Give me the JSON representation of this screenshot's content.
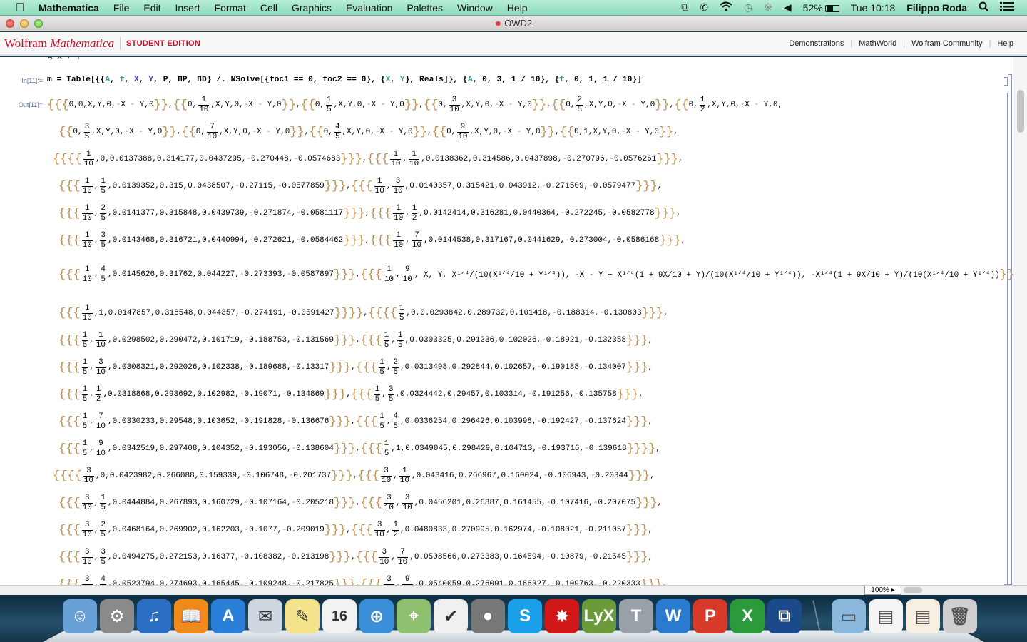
{
  "menubar": {
    "apple_icon": "apple-logo-icon",
    "app_name": "Mathematica",
    "menus": [
      "File",
      "Edit",
      "Insert",
      "Format",
      "Cell",
      "Graphics",
      "Evaluation",
      "Palettes",
      "Window",
      "Help"
    ],
    "status_icons": [
      "screen-mirroring-icon",
      "phone-icon",
      "wifi-icon",
      "time-machine-icon",
      "bluetooth-icon",
      "volume-icon"
    ],
    "battery": "52%",
    "clock": "Tue 10:18",
    "user": "Filippo Roda",
    "spotlight_icon": "search-icon",
    "notification_icon": "list-icon"
  },
  "window": {
    "title": "OWD2"
  },
  "wolfram_header": {
    "brand_wolfram": "Wolfram",
    "brand_mathematica": "Mathematica",
    "edition": "STUDENT EDITION",
    "links": [
      "Demonstrations",
      "MathWorld",
      "Wolfram Community",
      "Help"
    ]
  },
  "notebook": {
    "cut_text": "A X    + Y",
    "input_label": "In[11]:=",
    "output_label": "Out[11]=",
    "input_code": "m = Table[{{A, f, X, Y, P, ΠP, ΠD} /. NSolve[{foc1 == 0, foc2 == 0}, {X, Y}, Reals]}, {A, 0, 3, 1/10}, {f, 0, 1, 1/10}]",
    "input_parts": {
      "p1": "m = Table[{{",
      "A": "A",
      "c1": ", ",
      "f": "f",
      "c2": ", ",
      "X": "X",
      "c3": ", ",
      "Y": "Y",
      "p2": ", P, ΠP, ΠD} /. NSolve[{foc1 == 0, foc2 == 0}, {",
      "X2": "X",
      "c4": ", ",
      "Y2": "Y",
      "p3": "}, Reals]}, {",
      "A2": "A",
      "p4": ", 0, 3, 1 / 10}, {",
      "f2": "f",
      "p5": ", 0, 1, 1 / 10}]"
    },
    "symbolic_rows": [
      {
        "A": "0",
        "f": "0",
        "rest": "X, Y, 0, -X-Y, 0"
      },
      {
        "A": "0",
        "f": "1/10",
        "rest": "X, Y, 0, -X-Y, 0"
      },
      {
        "A": "0",
        "f": "1/5",
        "rest": "X, Y, 0, -X-Y, 0"
      },
      {
        "A": "0",
        "f": "3/10",
        "rest": "X, Y, 0, -X-Y, 0"
      },
      {
        "A": "0",
        "f": "2/5",
        "rest": "X, Y, 0, -X-Y, 0"
      },
      {
        "A": "0",
        "f": "1/2",
        "rest": "X, Y, 0, -X-Y, 0"
      },
      {
        "A": "0",
        "f": "3/5",
        "rest": "X, Y, 0, -X-Y, 0"
      },
      {
        "A": "0",
        "f": "7/10",
        "rest": "X, Y, 0, -X-Y, 0"
      },
      {
        "A": "0",
        "f": "4/5",
        "rest": "X, Y, 0, -X-Y, 0"
      },
      {
        "A": "0",
        "f": "9/10",
        "rest": "X, Y, 0, -X-Y, 0"
      },
      {
        "A": "0",
        "f": "1",
        "rest": "X, Y, 0, -X-Y, 0"
      }
    ],
    "numeric_rows": [
      {
        "A": "1/10",
        "f": "0",
        "v": [
          "0.0137388",
          "0.314177",
          "0.0437295",
          "-0.270448",
          "-0.0574683"
        ]
      },
      {
        "A": "1/10",
        "f": "1/10",
        "v": [
          "0.0138362",
          "0.314586",
          "0.0437898",
          "-0.270796",
          "-0.0576261"
        ]
      },
      {
        "A": "1/10",
        "f": "1/5",
        "v": [
          "0.0139352",
          "0.315",
          "0.0438507",
          "-0.27115",
          "-0.0577859"
        ]
      },
      {
        "A": "1/10",
        "f": "3/10",
        "v": [
          "0.0140357",
          "0.315421",
          "0.043912",
          "-0.271509",
          "-0.0579477"
        ]
      },
      {
        "A": "1/10",
        "f": "2/5",
        "v": [
          "0.0141377",
          "0.315848",
          "0.0439739",
          "-0.271874",
          "-0.0581117"
        ]
      },
      {
        "A": "1/10",
        "f": "1/2",
        "v": [
          "0.0142414",
          "0.316281",
          "0.0440364",
          "-0.272245",
          "-0.0582778"
        ]
      },
      {
        "A": "1/10",
        "f": "3/5",
        "v": [
          "0.0143468",
          "0.316721",
          "0.0440994",
          "-0.272621",
          "-0.0584462"
        ]
      },
      {
        "A": "1/10",
        "f": "7/10",
        "v": [
          "0.0144538",
          "0.317167",
          "0.0441629",
          "-0.273004",
          "-0.0586168"
        ]
      },
      {
        "A": "1/10",
        "f": "4/5",
        "v": [
          "0.0145626",
          "0.31762",
          "0.044227",
          "-0.273393",
          "-0.0587897"
        ]
      },
      {
        "A": "1/10",
        "f": "9/10",
        "symbolic": "X, Y, X^(1/4)/(10 (X^(1/4)/10 + Y^(1/4))), -X - Y + X^(1/4) (1 + 9X/10 + Y)/(10 (X^(1/4)/10 + Y^(1/4))), -X^(1/4) (1 + 9X/10 + Y)/(10 (X^(1/4)/10 + Y^(1/4)))"
      },
      {
        "A": "1/10",
        "f": "1",
        "v": [
          "0.0147857",
          "0.318548",
          "0.044357",
          "-0.274191",
          "-0.0591427"
        ]
      },
      {
        "A": "1/5",
        "f": "0",
        "v": [
          "0.0293842",
          "0.289732",
          "0.101418",
          "-0.188314",
          "-0.130803"
        ]
      },
      {
        "A": "1/5",
        "f": "1/10",
        "v": [
          "0.0298502",
          "0.290472",
          "0.101719",
          "-0.188753",
          "-0.131569"
        ]
      },
      {
        "A": "1/5",
        "f": "1/5",
        "v": [
          "0.0303325",
          "0.291236",
          "0.102026",
          "-0.18921",
          "-0.132358"
        ]
      },
      {
        "A": "1/5",
        "f": "3/10",
        "v": [
          "0.0308321",
          "0.292026",
          "0.102338",
          "-0.189688",
          "-0.13317"
        ]
      },
      {
        "A": "1/5",
        "f": "2/5",
        "v": [
          "0.0313498",
          "0.292844",
          "0.102657",
          "-0.190188",
          "-0.134007"
        ]
      },
      {
        "A": "1/5",
        "f": "1/2",
        "v": [
          "0.0318868",
          "0.293692",
          "0.102982",
          "-0.19071",
          "-0.134869"
        ]
      },
      {
        "A": "1/5",
        "f": "3/5",
        "v": [
          "0.0324442",
          "0.29457",
          "0.103314",
          "-0.191256",
          "-0.135758"
        ]
      },
      {
        "A": "1/5",
        "f": "7/10",
        "v": [
          "0.0330233",
          "0.29548",
          "0.103652",
          "-0.191828",
          "-0.136676"
        ]
      },
      {
        "A": "1/5",
        "f": "4/5",
        "v": [
          "0.0336254",
          "0.296426",
          "0.103998",
          "-0.192427",
          "-0.137624"
        ]
      },
      {
        "A": "1/5",
        "f": "9/10",
        "v": [
          "0.0342519",
          "0.297408",
          "0.104352",
          "-0.193056",
          "-0.138604"
        ]
      },
      {
        "A": "1/5",
        "f": "1",
        "v": [
          "0.0349045",
          "0.298429",
          "0.104713",
          "-0.193716",
          "-0.139618"
        ]
      },
      {
        "A": "3/10",
        "f": "0",
        "v": [
          "0.0423982",
          "0.266088",
          "0.159339",
          "-0.106748",
          "-0.201737"
        ]
      },
      {
        "A": "3/10",
        "f": "1/10",
        "v": [
          "0.043416",
          "0.266967",
          "0.160024",
          "-0.106943",
          "-0.20344"
        ]
      },
      {
        "A": "3/10",
        "f": "1/5",
        "v": [
          "0.0444884",
          "0.267893",
          "0.160729",
          "-0.107164",
          "-0.205218"
        ]
      },
      {
        "A": "3/10",
        "f": "3/10",
        "v": [
          "0.0456201",
          "0.26887",
          "0.161455",
          "-0.107416",
          "-0.207075"
        ]
      },
      {
        "A": "3/10",
        "f": "2/5",
        "v": [
          "0.0468164",
          "0.269902",
          "0.162203",
          "-0.1077",
          "-0.209019"
        ]
      },
      {
        "A": "3/10",
        "f": "1/2",
        "v": [
          "0.0480833",
          "0.270995",
          "0.162974",
          "-0.108021",
          "-0.211057"
        ]
      },
      {
        "A": "3/10",
        "f": "3/5",
        "v": [
          "0.0494275",
          "0.272153",
          "0.16377",
          "-0.108382",
          "-0.213198"
        ]
      },
      {
        "A": "3/10",
        "f": "7/10",
        "v": [
          "0.0508566",
          "0.273383",
          "0.164594",
          "-0.10879",
          "-0.21545"
        ]
      },
      {
        "A": "3/10",
        "f": "4/5",
        "v": [
          "0.0523794",
          "0.274693",
          "0.165445",
          "-0.109248",
          "-0.217825"
        ]
      },
      {
        "A": "3/10",
        "f": "9/10",
        "v": [
          "0.0540059",
          "0.276091",
          "0.166327",
          "-0.109763",
          "-0.220333"
        ]
      }
    ]
  },
  "statusbar": {
    "zoom": "100%"
  },
  "dock": {
    "apps": [
      "Finder",
      "System Preferences",
      "iTunes",
      "iBooks",
      "App Store",
      "Mail",
      "Notes",
      "Calendar",
      "Safari",
      "Maps",
      "Reminders",
      "FaceTime",
      "Skype",
      "Mathematica",
      "LyX",
      "TeXShop",
      "Word",
      "PowerPoint",
      "Excel",
      "VMware Fusion"
    ],
    "calendar_month": "SEP",
    "calendar_day": "16",
    "stacks": [
      "Documents",
      "Screenshot",
      "LyX Document",
      "Trash"
    ]
  }
}
